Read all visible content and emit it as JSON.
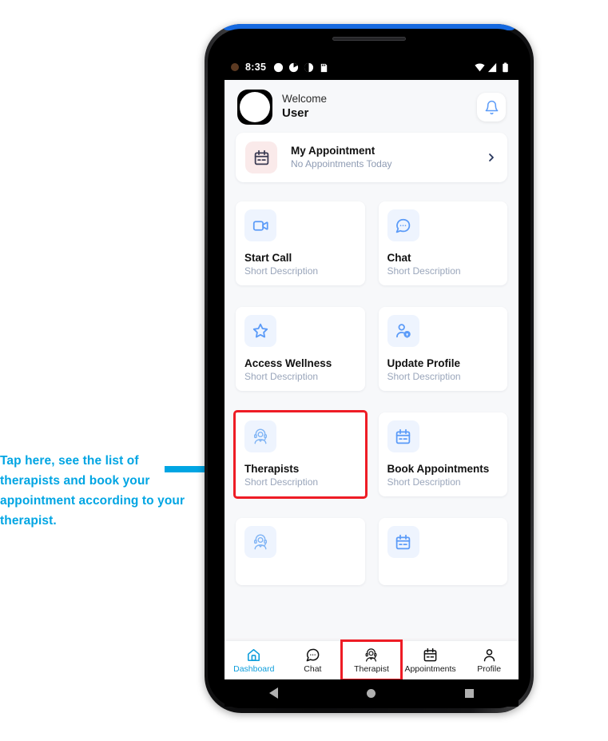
{
  "annotation": {
    "text": "Tap here, see the list of therapists and book your appointment according to your therapist.",
    "color": "#00a5e3",
    "arrow_icon": "right-arrow-icon"
  },
  "phone": {
    "top_accent_color": "#1569e0",
    "frame_color": "#121214"
  },
  "status_bar": {
    "time": "8:35",
    "left_icons": [
      "dot-indicator-icon",
      "circle-icon",
      "pie-icon",
      "half-circle-icon",
      "sd-card-icon"
    ],
    "right_icons": [
      "wifi-icon",
      "signal-icon",
      "battery-icon"
    ]
  },
  "header": {
    "avatar": "avatar-placeholder",
    "welcome_label": "Welcome",
    "user_name": "User",
    "bell_icon": "notification-bell-icon"
  },
  "appointment_card": {
    "icon": "calendar-icon",
    "icon_bg": "#faeaea",
    "title": "My Appointment",
    "subtitle": "No Appointments Today",
    "chevron_icon": "chevron-right-icon"
  },
  "cards": [
    {
      "icon": "video-camera-icon",
      "title": "Start Call",
      "subtitle": "Short Description",
      "highlighted": false
    },
    {
      "icon": "chat-bubble-icon",
      "title": "Chat",
      "subtitle": "Short Description",
      "highlighted": false
    },
    {
      "icon": "star-icon",
      "title": "Access Wellness",
      "subtitle": "Short Description",
      "highlighted": false
    },
    {
      "icon": "user-settings-icon",
      "title": "Update Profile",
      "subtitle": "Short Description",
      "highlighted": false
    },
    {
      "icon": "therapist-headset-icon",
      "title": "Therapists",
      "subtitle": "Short Description",
      "highlighted": true
    },
    {
      "icon": "calendar-icon",
      "title": "Book Appointments",
      "subtitle": "Short Description",
      "highlighted": false
    },
    {
      "icon": "therapist-headset-icon",
      "title": "",
      "subtitle": "",
      "highlighted": false
    },
    {
      "icon": "calendar-icon",
      "title": "",
      "subtitle": "",
      "highlighted": false
    }
  ],
  "bottom_nav": {
    "active_color": "#0d9ddb",
    "items": [
      {
        "icon": "home-icon",
        "label": "Dashboard",
        "active": true,
        "boxed": false
      },
      {
        "icon": "chat-bubble-icon",
        "label": "Chat",
        "active": false,
        "boxed": false
      },
      {
        "icon": "therapist-headset-icon",
        "label": "Therapist",
        "active": false,
        "boxed": true
      },
      {
        "icon": "calendar-icon",
        "label": "Appointments",
        "active": false,
        "boxed": false
      },
      {
        "icon": "person-icon",
        "label": "Profile",
        "active": false,
        "boxed": false
      }
    ]
  },
  "android_nav": {
    "back_icon": "back-triangle-icon",
    "home_icon": "home-circle-icon",
    "recents_icon": "recents-square-icon"
  },
  "highlight_color": "#ee1c25"
}
